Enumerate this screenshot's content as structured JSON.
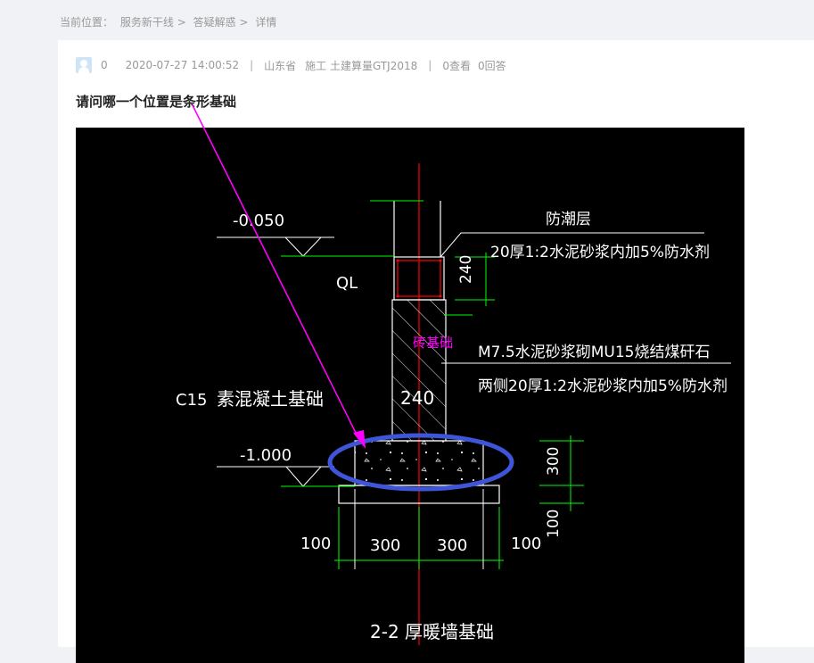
{
  "breadcrumb": {
    "prefix": "当前位置：",
    "items": [
      "服务新干线",
      "答疑解惑",
      "详情"
    ],
    "separator": ">"
  },
  "question": {
    "user": "0",
    "datetime": "2020-07-27 14:00:52",
    "region": "山东省",
    "category": "施工 土建算量GTJ2018",
    "views": "0查看",
    "answers": "0回答",
    "title": "请问哪一个位置是条形基础"
  },
  "drawing": {
    "background": "#000000",
    "labels": {
      "level_top": "-0.050",
      "level_bottom": "-1.000",
      "ql": "QL",
      "damp_proof": "防潮层",
      "damp_proof_spec": "20厚1:2水泥砂浆内加5%防水剂",
      "dim_240_vertical": "240",
      "brick_foundation": "砖基础",
      "mortar_spec": "M7.5水泥砂浆砌MU15烧结煤矸石",
      "both_sides_spec": "两侧20厚1:2水泥砂浆内加5%防水剂",
      "c15": "C15",
      "plain_concrete": "素混凝土基础",
      "dim_240_wall": "240",
      "dim_300_right": "300",
      "dim_100_right": "100",
      "dim_100_left": "100",
      "dim_300_a": "300",
      "dim_300_b": "300",
      "dim_100_b": "100",
      "bottom_caption": "2-2 厚暖墙基础"
    },
    "colors": {
      "dimension_green": "#00ff00",
      "axis_red": "#ff0000",
      "annotation_magenta": "#ff00ff",
      "highlight_blue": "#3f55d8"
    }
  }
}
